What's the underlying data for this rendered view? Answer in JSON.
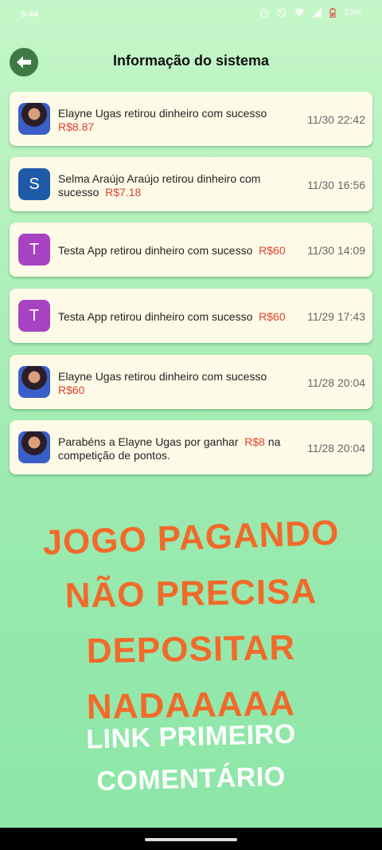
{
  "status": {
    "time": "5:44",
    "battery": "73%"
  },
  "header": {
    "title": "Informação do sistema"
  },
  "notifications": [
    {
      "avatar": "",
      "text": "Elayne Ugas  retirou dinheiro com sucesso",
      "amount": "R$8.87",
      "suffix": "",
      "time": "11/30 22:42"
    },
    {
      "avatar": "S",
      "text": "Selma Araújo Araújo  retirou dinheiro com sucesso",
      "amount": "R$7.18",
      "suffix": "",
      "time": "11/30 16:56"
    },
    {
      "avatar": "T",
      "text": "Testa App  retirou dinheiro com sucesso",
      "amount": "R$60",
      "suffix": "",
      "time": "11/30 14:09"
    },
    {
      "avatar": "T",
      "text": "Testa App  retirou dinheiro com sucesso",
      "amount": "R$60",
      "suffix": "",
      "time": "11/29 17:43"
    },
    {
      "avatar": "",
      "text": "Elayne Ugas  retirou dinheiro com sucesso",
      "amount": "R$60",
      "suffix": "",
      "time": "11/28 20:04"
    },
    {
      "avatar": "",
      "text": "Parabéns a Elayne Ugas  por ganhar",
      "amount": "R$8",
      "suffix": " na competição de pontos.",
      "time": "11/28 20:04"
    }
  ],
  "promo": {
    "line1": "JOGO PAGANDO",
    "line2": "NÃO PRECISA",
    "line3": "DEPOSITAR",
    "line4": "NADAAAAA",
    "line5": "LINK PRIMEIRO",
    "line6": "COMENTÁRIO"
  },
  "colors": {
    "amount": "#e2402b",
    "promo": "#f26a2a",
    "card": "#fdfbe8",
    "back_button": "#3f7a45"
  }
}
